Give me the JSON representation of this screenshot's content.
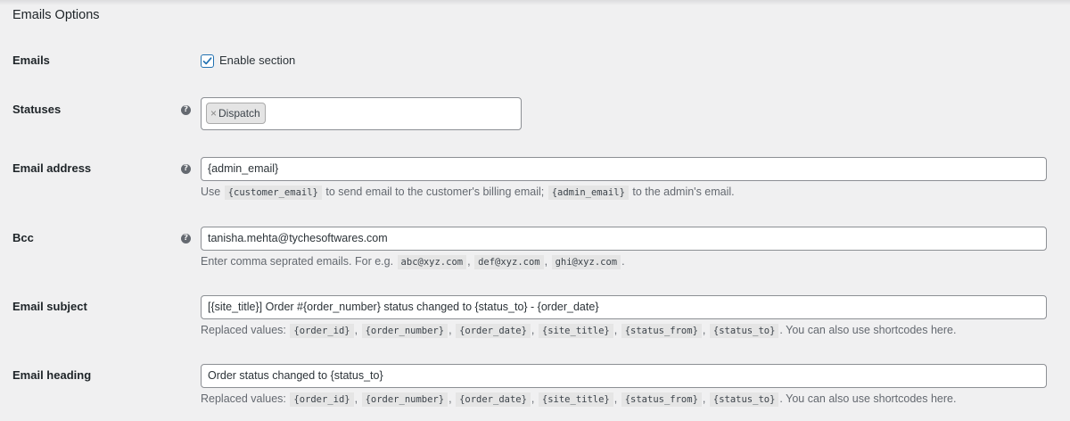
{
  "section_title": "Emails Options",
  "emails": {
    "label": "Emails",
    "checkbox_label": "Enable section",
    "checked": true
  },
  "statuses": {
    "label": "Statuses",
    "help": "?",
    "selected": [
      {
        "remove": "×",
        "label": "Dispatch"
      }
    ]
  },
  "email_address": {
    "label": "Email address",
    "help": "?",
    "value": "{admin_email}",
    "desc_1": "Use",
    "code_1": "{customer_email}",
    "desc_2": "to send email to the customer's billing email;",
    "code_2": "{admin_email}",
    "desc_3": "to the admin's email."
  },
  "bcc": {
    "label": "Bcc",
    "help": "?",
    "value": "tanisha.mehta@tychesoftwares.com",
    "desc_prefix": "Enter comma seprated emails. For e.g.",
    "examples": [
      "abc@xyz.com",
      "def@xyz.com",
      "ghi@xyz.com"
    ],
    "sep": ",",
    "end": "."
  },
  "email_subject": {
    "label": "Email subject",
    "value": "[{site_title}] Order #{order_number} status changed to {status_to} - {order_date}",
    "desc_prefix": "Replaced values:",
    "codes": [
      "{order_id}",
      "{order_number}",
      "{order_date}",
      "{site_title}",
      "{status_from}",
      "{status_to}"
    ],
    "sep": ",",
    "desc_suffix": ". You can also use shortcodes here."
  },
  "email_heading": {
    "label": "Email heading",
    "value": "Order status changed to {status_to}",
    "desc_prefix": "Replaced values:",
    "codes": [
      "{order_id}",
      "{order_number}",
      "{order_date}",
      "{site_title}",
      "{status_from}",
      "{status_to}"
    ],
    "sep": ",",
    "desc_suffix": ". You can also use shortcodes here."
  },
  "colors": {
    "accent": "#2271b1",
    "background": "#f0f0f1",
    "text": "#1d2327",
    "muted": "#646970"
  }
}
